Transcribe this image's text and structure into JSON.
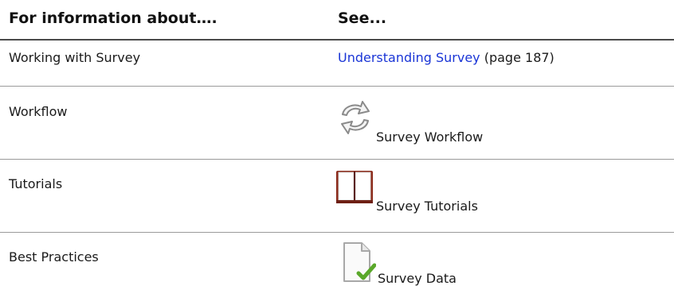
{
  "header": {
    "col1": "For information about….",
    "col2": "See..."
  },
  "rows": [
    {
      "topic": "Working with Survey",
      "link_text": "Understanding Survey",
      "page_ref": "(page 187)"
    },
    {
      "topic": "Workflow",
      "icon": "refresh-cycle-icon",
      "see": "Survey Workflow"
    },
    {
      "topic": "Tutorials",
      "icon": "book-icon",
      "see": "Survey Tutorials"
    },
    {
      "topic": "Best Practices",
      "icon": "document-check-icon",
      "see": "Survey Data"
    }
  ],
  "colors": {
    "link": "#1a35d6",
    "book_cover": "#8b2a1a",
    "check": "#5aa82a"
  }
}
